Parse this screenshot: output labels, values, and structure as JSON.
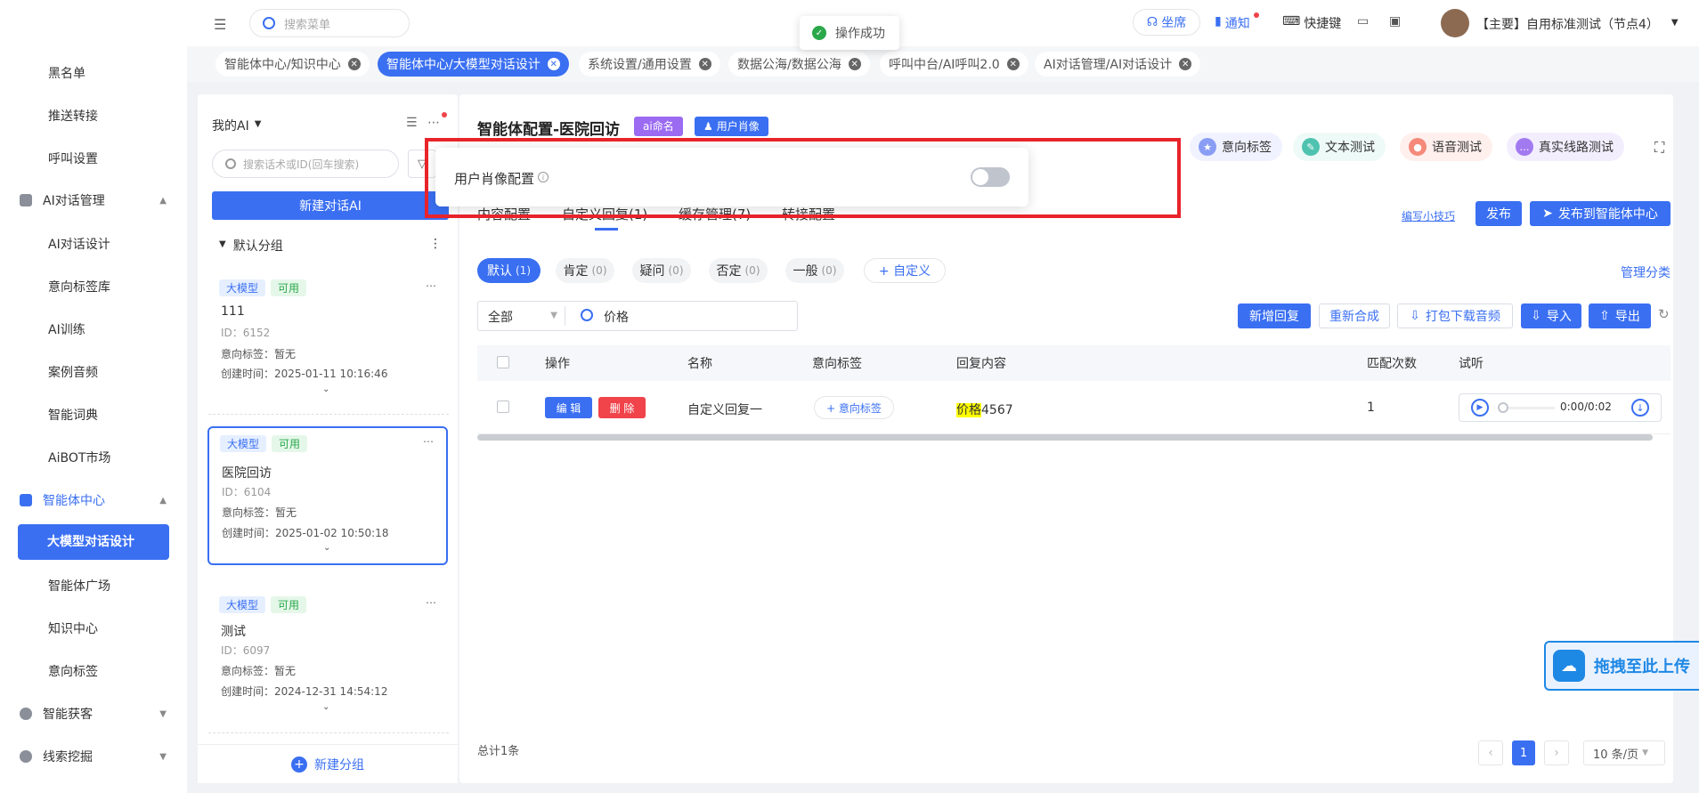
{
  "sidebar": {
    "items": [
      {
        "label": "黑名单"
      },
      {
        "label": "推送转接"
      },
      {
        "label": "呼叫设置"
      }
    ],
    "group_ai": {
      "label": "AI对话管理"
    },
    "group_ai_items": [
      {
        "label": "AI对话设计"
      },
      {
        "label": "意向标签库"
      },
      {
        "label": "AI训练"
      },
      {
        "label": "案例音频"
      },
      {
        "label": "智能词典"
      },
      {
        "label": "AiBOT市场"
      }
    ],
    "group_agent": {
      "label": "智能体中心"
    },
    "active_item": {
      "label": "大模型对话设计"
    },
    "group_agent_items": [
      {
        "label": "智能体广场"
      },
      {
        "label": "知识中心"
      },
      {
        "label": "意向标签"
      }
    ],
    "group_acquire": {
      "label": "智能获客"
    },
    "group_clue": {
      "label": "线索挖掘"
    }
  },
  "topbar": {
    "search_placeholder": "搜索菜单",
    "toast": "操作成功",
    "seat": "坐席",
    "notify": "通知",
    "shortcut": "快捷键",
    "user": "【主要】自用标准测试（节点4）"
  },
  "tabs": [
    {
      "label": "智能体中心/知识中心"
    },
    {
      "label": "智能体中心/大模型对话设计"
    },
    {
      "label": "系统设置/通用设置"
    },
    {
      "label": "数据公海/数据公海"
    },
    {
      "label": "呼叫中台/AI呼叫2.0"
    },
    {
      "label": "AI对话管理/AI对话设计"
    }
  ],
  "left": {
    "title": "我的AI",
    "search_placeholder": "搜索话术或ID(回车搜索)",
    "new_button": "新建对话AI",
    "group": "默认分组",
    "new_group": "新建分组",
    "cards": [
      {
        "tag1": "大模型",
        "tag2": "可用",
        "name": "111",
        "id": "ID：6152",
        "intent": "意向标签：暂无",
        "created": "创建时间：2025-01-11 10:16:46"
      },
      {
        "tag1": "大模型",
        "tag2": "可用",
        "name": "医院回访",
        "id": "ID：6104",
        "intent": "意向标签：暂无",
        "created": "创建时间：2025-01-02 10:50:18"
      },
      {
        "tag1": "大模型",
        "tag2": "可用",
        "name": "测试",
        "id": "ID：6097",
        "intent": "意向标签：暂无",
        "created": "创建时间：2024-12-31 14:54:12"
      }
    ]
  },
  "main": {
    "title": "智能体配置-医院回访",
    "tag_ai": "ai命名",
    "tag_portrait": "用户肖像",
    "actions": [
      {
        "label": "意向标签"
      },
      {
        "label": "文本测试"
      },
      {
        "label": "语音测试"
      },
      {
        "label": "真实线路测试"
      }
    ],
    "subtabs": [
      {
        "label": "内容配置"
      },
      {
        "label": "自定义回复(1)"
      },
      {
        "label": "缓存管理(7)"
      },
      {
        "label": "转接配置"
      }
    ],
    "tips_link": "编写小技巧",
    "publish": "发布",
    "publish_center": "发布到智能体中心",
    "categories": [
      {
        "label": "默认",
        "count": "(1)"
      },
      {
        "label": "肯定",
        "count": "(0)"
      },
      {
        "label": "疑问",
        "count": "(0)"
      },
      {
        "label": "否定",
        "count": "(0)"
      },
      {
        "label": "一般",
        "count": "(0)"
      }
    ],
    "custom_cat": "+ 自定义",
    "manage_cat": "管理分类",
    "filter_select": "全部",
    "filter_search": "价格",
    "toolbar": {
      "new_reply": "新增回复",
      "resynth": "重新合成",
      "download": "打包下载音频",
      "import": "导入",
      "export": "导出"
    },
    "table": {
      "headers": [
        "操作",
        "名称",
        "意向标签",
        "回复内容",
        "匹配次数",
        "试听"
      ],
      "rows": [
        {
          "edit": "编 辑",
          "delete": "删 除",
          "name": "自定义回复一",
          "intent": "+ 意向标签",
          "content_highlight": "价格",
          "content_rest": "4567",
          "count": "1",
          "audio_time": "0:00/0:02"
        }
      ]
    },
    "total": "总计1条",
    "pagination": {
      "page": "1",
      "size": "10 条/页"
    }
  },
  "popover": {
    "label": "用户肖像配置",
    "toggle_state": "off"
  },
  "upload_float": "拖拽至此上传",
  "colors": {
    "primary": "#3a6ff2",
    "danger": "#f0434a",
    "highlight": "#ffff00",
    "annotation": "#e8232a"
  }
}
